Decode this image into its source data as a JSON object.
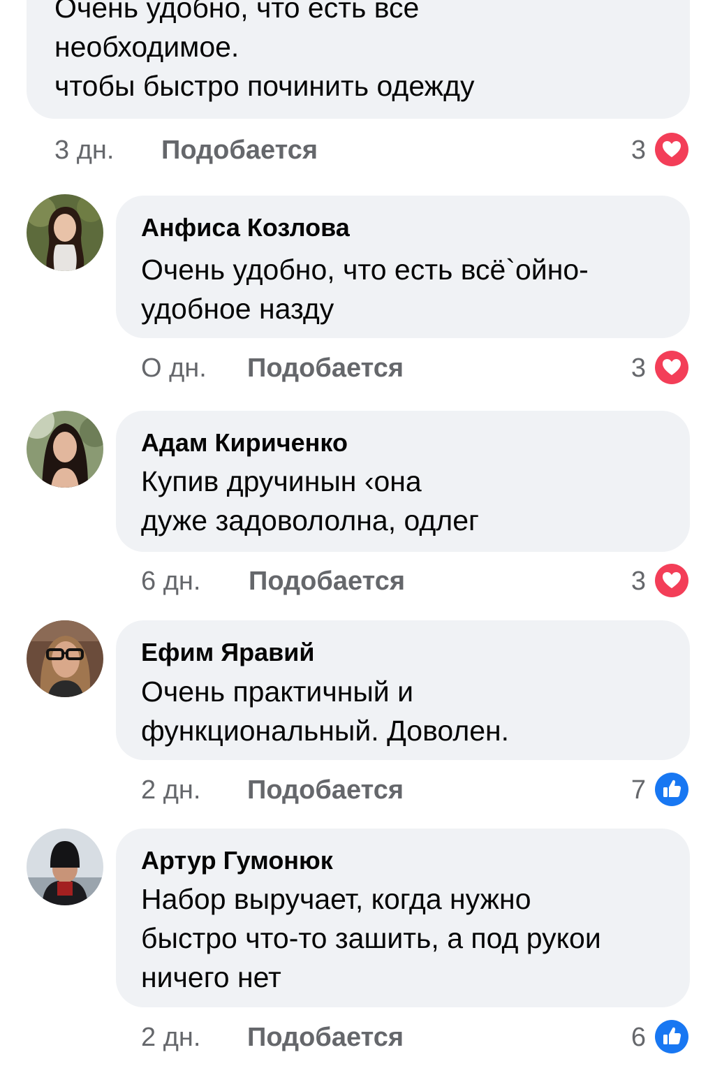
{
  "colors": {
    "bubble": "#f0f2f5",
    "meta_text": "#65676b",
    "love_red": "#f33e58",
    "like_blue": "#1877f2"
  },
  "like_label": "Подобается",
  "comments": [
    {
      "author": "",
      "lines": [
        "Очень удобно, что есть все",
        "необходимое.",
        "чтобы быстро починить одежду"
      ],
      "time": "3 дн.",
      "reaction_count": "3",
      "reaction_icon": "heart-icon"
    },
    {
      "author": "Анфиса Козлова",
      "lines": [
        "Очень удобно, что есть всё`ойно-",
        "удобное назду"
      ],
      "time": "О дн.",
      "reaction_count": "3",
      "reaction_icon": "heart-icon"
    },
    {
      "author": "Адам Кириченко",
      "lines": [
        "Купив дручинын ‹она",
        "дуже задовололна, одлег"
      ],
      "time": "6 дн.",
      "reaction_count": "3",
      "reaction_icon": "heart-icon"
    },
    {
      "author": "Ефим Яравий",
      "lines": [
        "Очень практичный и",
        "функциональный. Доволен."
      ],
      "time": "2 дн.",
      "reaction_count": "7",
      "reaction_icon": "thumbs-up-icon"
    },
    {
      "author": "Артур Гумонюк",
      "lines": [
        "Набор выручает, когда нужно",
        "быстро что-то зашить, а под рукои",
        "ничего нет"
      ],
      "time": "2 дн.",
      "reaction_count": "6",
      "reaction_icon": "thumbs-up-icon"
    }
  ]
}
